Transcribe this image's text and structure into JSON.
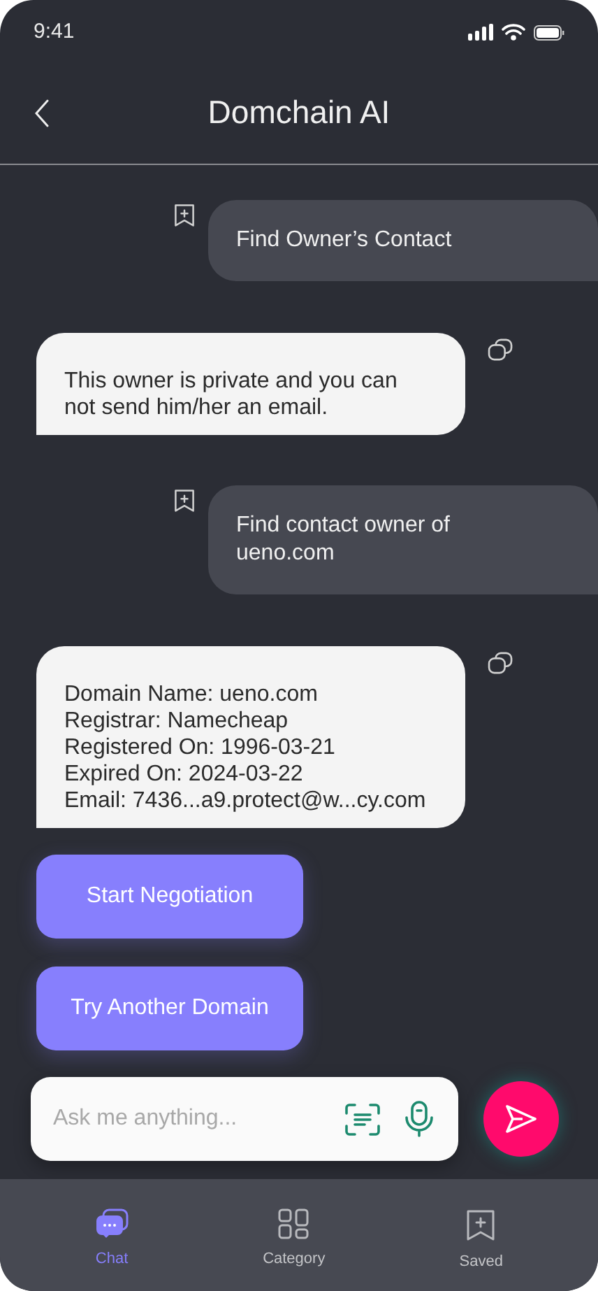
{
  "status_bar": {
    "time": "9:41"
  },
  "header": {
    "title": "Domchain AI"
  },
  "messages": [
    {
      "kind": "user",
      "text": "Find Owner’s Contact"
    },
    {
      "kind": "bot",
      "text": "This owner is private and you can not send him/her an email."
    },
    {
      "kind": "user",
      "text": "Find contact owner of ueno.com"
    },
    {
      "kind": "bot",
      "lines": [
        "Domain Name: ueno.com",
        "Registrar: Namecheap",
        "Registered On: 1996-03-21",
        "Expired On: 2024-03-22",
        "Email: 7436...a9.protect@w...cy.com"
      ]
    }
  ],
  "actions": [
    "Start Negotiation",
    "Try Another Domain"
  ],
  "composer": {
    "placeholder": "Ask me anything..."
  },
  "nav": [
    {
      "label": "Chat",
      "selected": true
    },
    {
      "label": "Category",
      "selected": false
    },
    {
      "label": "Saved",
      "selected": false
    }
  ]
}
